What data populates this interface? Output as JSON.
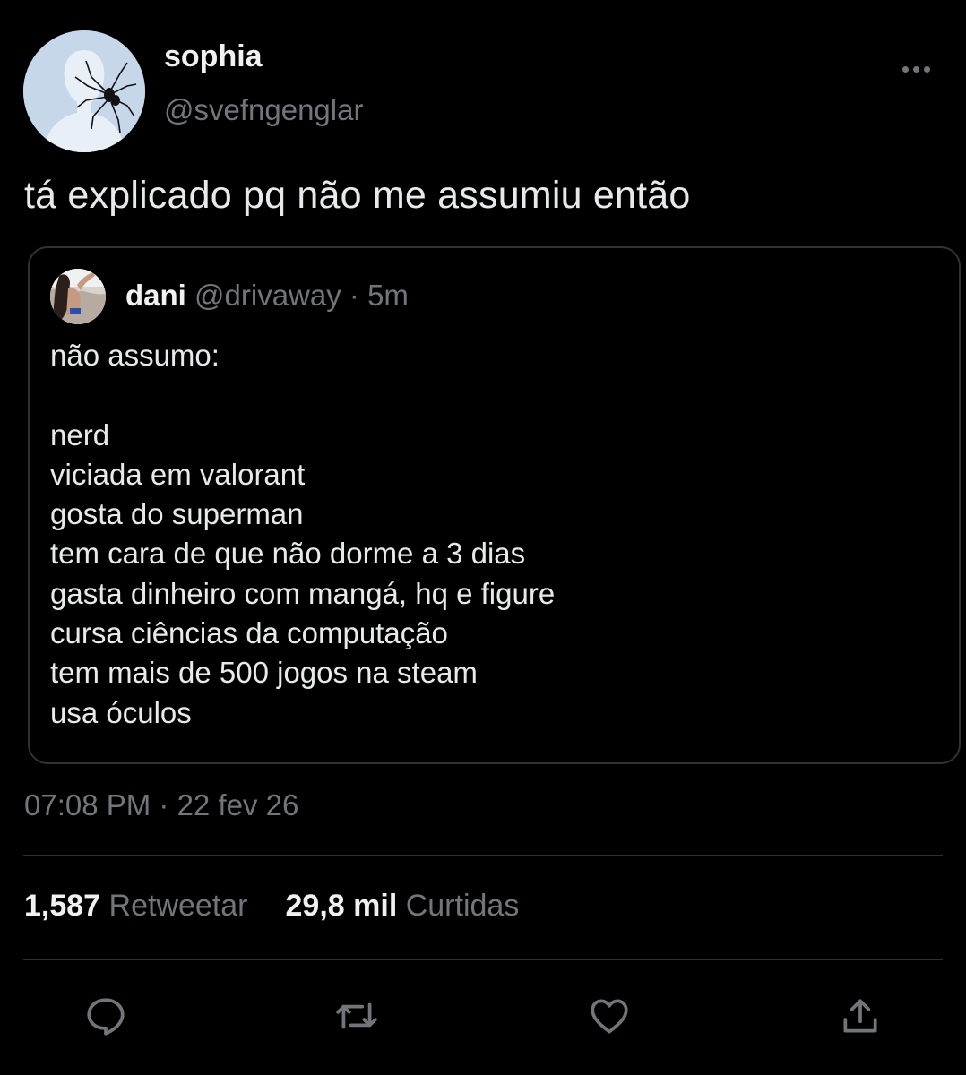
{
  "tweet": {
    "author": {
      "name": "sophia",
      "handle": "@svefngenglar"
    },
    "text": "tá explicado pq não me assumiu então",
    "quoted": {
      "name": "dani",
      "handle": "@drivaway",
      "separator": " · ",
      "age": "5m",
      "lines": [
        "não assumo:",
        "",
        "nerd",
        "viciada em valorant",
        "gosta do superman",
        "tem cara de que não dorme a 3 dias",
        "gasta dinheiro com mangá, hq e figure",
        "cursa ciências da computação",
        "tem mais de 500 jogos na steam",
        "usa óculos"
      ]
    },
    "timestamp": "07:08 PM · 22 fev 26",
    "stats": {
      "retweets_count": "1,587",
      "retweets_label": "Retweetar",
      "likes_count": "29,8 mil",
      "likes_label": "Curtidas"
    }
  },
  "icons": {
    "more": "more-horizontal-icon",
    "reply": "reply-icon",
    "retweet": "retweet-icon",
    "like": "heart-icon",
    "share": "share-icon"
  },
  "colors": {
    "background": "#000000",
    "text": "#e7e9ea",
    "muted": "#71767b",
    "border": "#2f3336",
    "icon": "#71767b"
  }
}
